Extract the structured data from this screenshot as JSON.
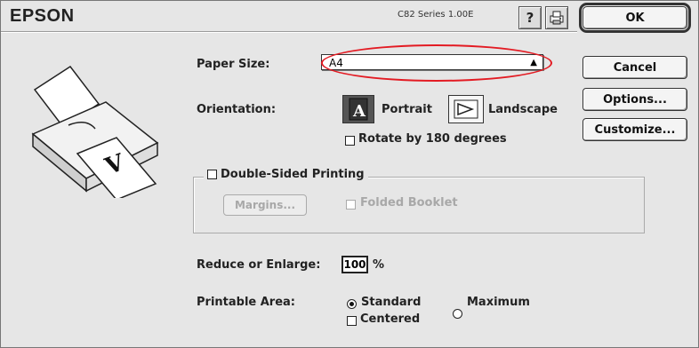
{
  "brand": "EPSON",
  "version": "C82 Series 1.00E",
  "header_icons": {
    "help": "?",
    "printer_icon": "printer-settings-icon"
  },
  "buttons": {
    "ok": "OK",
    "cancel": "Cancel",
    "options": "Options...",
    "customize": "Customize..."
  },
  "paper_size": {
    "label": "Paper Size:",
    "value": "A4"
  },
  "orientation": {
    "label": "Orientation:",
    "portrait": "Portrait",
    "landscape": "Landscape",
    "selected": "Portrait",
    "rotate_label": "Rotate by 180 degrees",
    "rotate_checked": false
  },
  "double_sided": {
    "label": "Double-Sided Printing",
    "checked": false,
    "margins_button": "Margins...",
    "folded_booklet": "Folded Booklet"
  },
  "reduce_enlarge": {
    "label": "Reduce or Enlarge:",
    "value": "100",
    "unit": "%"
  },
  "printable_area": {
    "label": "Printable Area:",
    "standard": "Standard",
    "maximum": "Maximum",
    "selected": "Standard",
    "centered_label": "Centered",
    "centered_checked": false
  },
  "colors": {
    "highlight": "#e31b23",
    "dialog_bg": "#e6e6e6"
  }
}
